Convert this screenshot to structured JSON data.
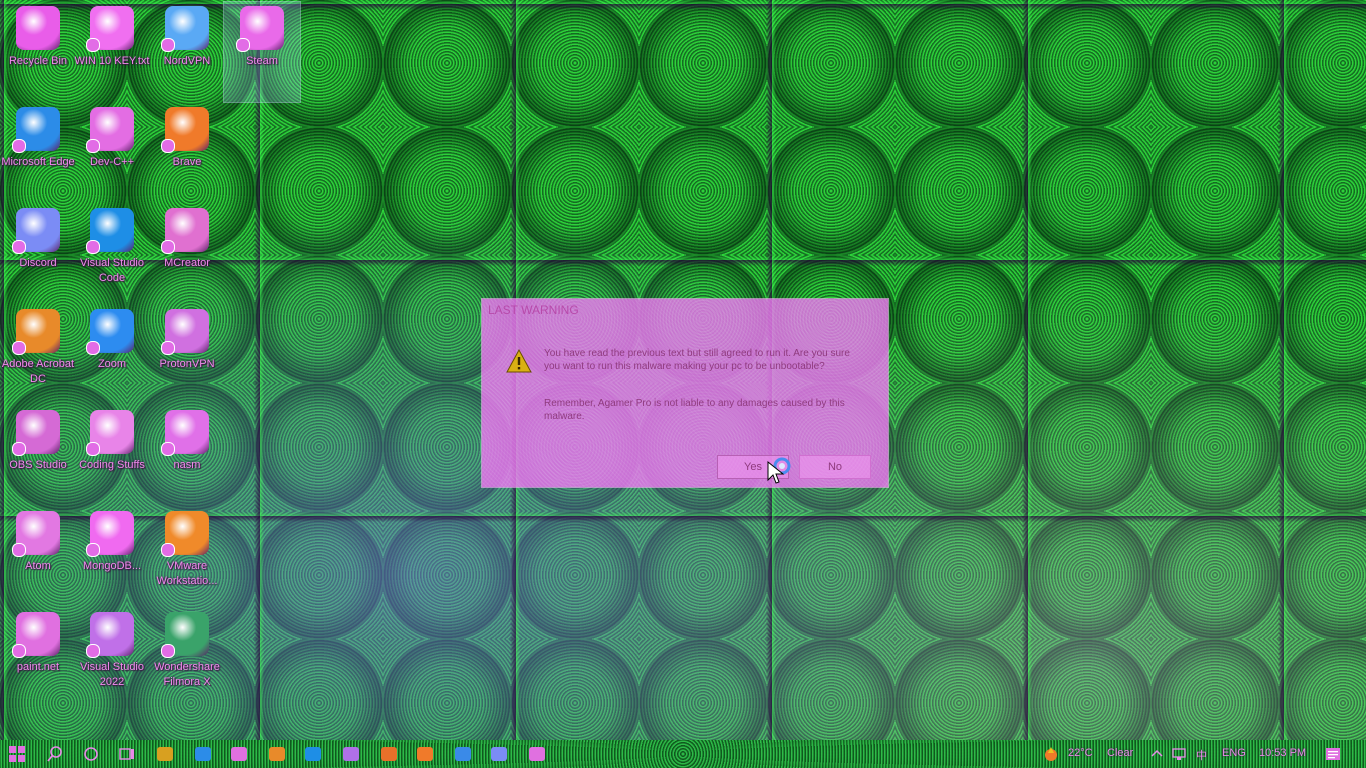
{
  "desktop": {
    "icons": [
      {
        "label": "Recycle Bin",
        "icon": "recycle-bin-icon",
        "color": "#e95de9"
      },
      {
        "label": "WIN 10 KEY.txt",
        "icon": "text-file-icon",
        "color": "#f06ff0"
      },
      {
        "label": "NordVPN",
        "icon": "nordvpn-icon",
        "color": "#5aa9f5"
      },
      {
        "label": "Steam",
        "icon": "steam-icon",
        "color": "#e96ae9"
      },
      {
        "label": "Microsoft Edge",
        "icon": "edge-icon",
        "color": "#2c8ce8"
      },
      {
        "label": "Dev-C++",
        "icon": "devcpp-icon",
        "color": "#e36de3"
      },
      {
        "label": "Brave",
        "icon": "brave-icon",
        "color": "#f07a2a"
      },
      {
        "label": "Discord",
        "icon": "discord-icon",
        "color": "#7b8cf5"
      },
      {
        "label": "Visual Studio Code",
        "icon": "vscode-icon",
        "color": "#1e8ee6"
      },
      {
        "label": "MCreator",
        "icon": "mcreator-icon",
        "color": "#e070d0"
      },
      {
        "label": "Adobe Acrobat DC",
        "icon": "acrobat-icon",
        "color": "#e88a2a"
      },
      {
        "label": "Zoom",
        "icon": "zoom-icon",
        "color": "#2d8cf0"
      },
      {
        "label": "ProtonVPN",
        "icon": "protonvpn-icon",
        "color": "#d070e0"
      },
      {
        "label": "OBS Studio",
        "icon": "obs-icon",
        "color": "#d56ad5"
      },
      {
        "label": "Coding Stuffs",
        "icon": "folder-icon",
        "color": "#e884e8"
      },
      {
        "label": "nasm",
        "icon": "nasm-icon",
        "color": "#e070e8"
      },
      {
        "label": "Atom",
        "icon": "atom-icon",
        "color": "#e278e2"
      },
      {
        "label": "MongoDB...",
        "icon": "mongodb-icon",
        "color": "#f06af0"
      },
      {
        "label": "VMware Workstatio...",
        "icon": "vmware-icon",
        "color": "#f08a2a"
      },
      {
        "label": "paint.net",
        "icon": "paintnet-icon",
        "color": "#e070e0"
      },
      {
        "label": "Visual Studio 2022",
        "icon": "visual-studio-icon",
        "color": "#c070e8"
      },
      {
        "label": "Wondershare Filmora X",
        "icon": "filmora-icon",
        "color": "#3aa36a"
      }
    ]
  },
  "dialog": {
    "title": "LAST WARNING",
    "text1": "You have read the previous text but still agreed to run it. Are you sure you want to run this malware making your pc to be unbootable?",
    "text2": "Remember, Agamer Pro is not liable to any damages caused by this malware.",
    "yes_label": "Yes",
    "no_label": "No",
    "accent": "#ec78f0"
  },
  "taskbar": {
    "weather_temp": "22°C",
    "weather_text": "Clear",
    "language": "ENG",
    "time": "10:53 PM",
    "ime": "中",
    "pinned": [
      "start-icon",
      "search-icon",
      "cortana-icon",
      "task-view-icon",
      "explorer-icon",
      "edge-icon",
      "store-icon",
      "chrome-icon",
      "vscode-icon",
      "visual-studio-icon",
      "office-icon",
      "firefox-icon",
      "chrome2-icon",
      "discord-icon",
      "camera-icon"
    ]
  }
}
